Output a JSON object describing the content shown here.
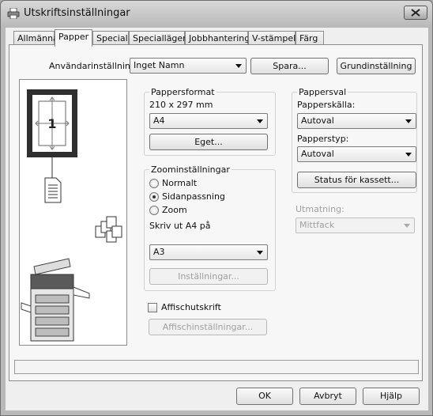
{
  "window": {
    "title": "Utskriftsinställningar",
    "close_icon": "close-x-icon"
  },
  "tabs": [
    {
      "label": "Allmänna",
      "active": false
    },
    {
      "label": "Papper",
      "active": true
    },
    {
      "label": "Special",
      "active": false
    },
    {
      "label": "Speciallägen",
      "active": false
    },
    {
      "label": "Jobbhantering",
      "active": false
    },
    {
      "label": "V-stämpel",
      "active": false
    },
    {
      "label": "Färg",
      "active": false
    }
  ],
  "user_settings": {
    "label": "Användarinställningar:",
    "value": "Inget Namn",
    "save_label": "Spara...",
    "default_label": "Grundinställning"
  },
  "preview": {
    "page_number": "1",
    "paper_icon": "document-icon",
    "multi_page_icon": "multiple-pages-icon",
    "printer_icon": "printer-copier-icon"
  },
  "paper_size": {
    "group_title": "Pappersformat",
    "dimensions": "210 x 297 mm",
    "value": "A4",
    "custom_label": "Eget..."
  },
  "zoom": {
    "group_title": "Zoominställningar",
    "options": [
      {
        "label": "Normalt",
        "checked": false
      },
      {
        "label": "Sidanpassning",
        "checked": true
      },
      {
        "label": "Zoom",
        "checked": false
      }
    ],
    "fit_label": "Skriv ut A4 på",
    "fit_value": "A3",
    "settings_label": "Inställningar..."
  },
  "poster": {
    "checkbox_label": "Affischutskrift",
    "settings_label": "Affischinställningar..."
  },
  "paper_selection": {
    "group_title": "Pappersval",
    "source_label": "Papperskälla:",
    "source_value": "Autoval",
    "type_label": "Papperstyp:",
    "type_value": "Autoval",
    "status_label": "Status för kassett..."
  },
  "output": {
    "label": "Utmatning:",
    "value": "Mittfack"
  },
  "dialog_buttons": {
    "ok": "OK",
    "cancel": "Avbryt",
    "help": "Hjälp"
  }
}
